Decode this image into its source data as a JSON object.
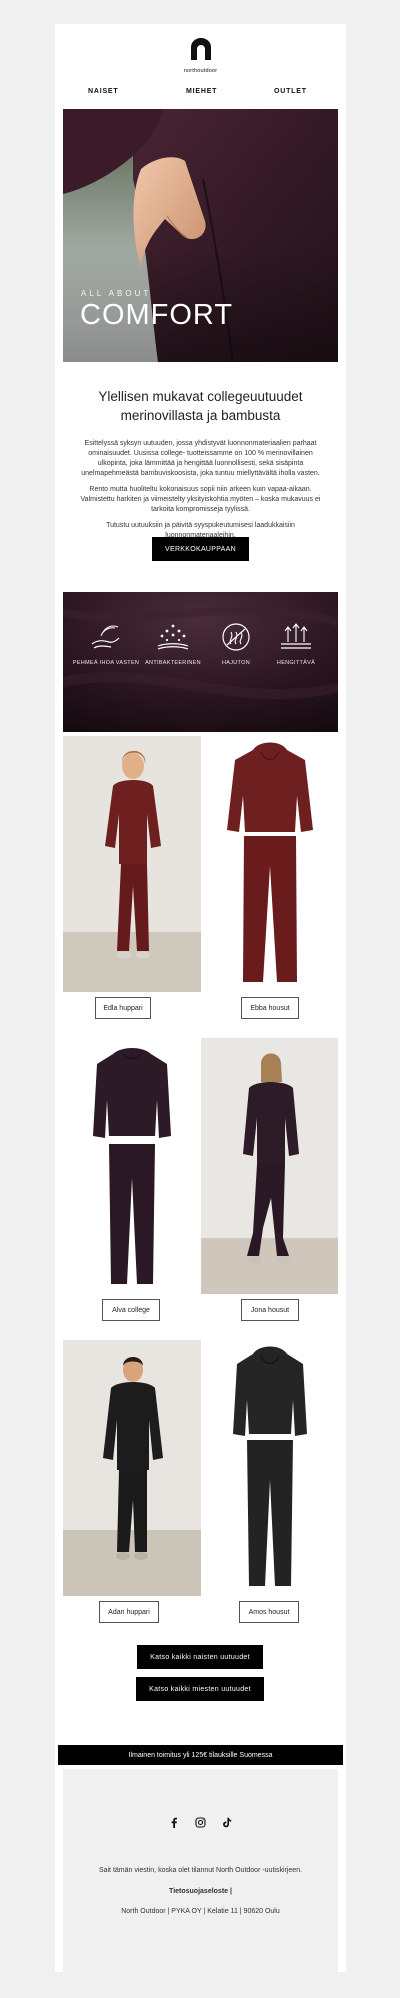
{
  "brand": {
    "logo_text": "northoutdoor"
  },
  "nav": {
    "women": "NAISET",
    "men": "MIEHET",
    "outlet": "OUTLET"
  },
  "hero": {
    "kicker": "ALL ABOUT",
    "title": "COMFORT"
  },
  "intro": {
    "headline": "Ylellisen mukavat collegeuutuudet merinovillasta ja bambusta",
    "p1": "Esittelyssä syksyn uutuuden, jossa yhdistyvät luonnonmateriaalien parhaat ominaisuudet. Uusissa college- tuotteissamme on 100 % merinovillainen ulkopinta, joka lämmittää ja hengittää luonnollisesti, sekä sisäpinta unelmapehmeästä bambuviskoosista, joka tuntuu miellyttävältä iholla vasten.",
    "p2": "Rento mutta huoliteltu kokonaisuus sopii niin arkeen kuin vapaa-aikaan. Valmistettu harkiten ja viimeistelty yksityiskohtia myöten – koska mukavuus ei tarkoita kompromisseja tyylissä.",
    "p3": "Tutustu uutuuksiin ja päivitä syyspukeutumisesi laadukkaisiin luonnonmateriaaleihin.",
    "cta": "VERKKOKAUPPAAN"
  },
  "features": [
    {
      "icon": "soft-hand-icon",
      "label": "PEHMEÄ IHOA VASTEN"
    },
    {
      "icon": "antibacterial-icon",
      "label": "ANTIBAKTEERINEN"
    },
    {
      "icon": "odorless-icon",
      "label": "HAJUTON"
    },
    {
      "icon": "breathable-icon",
      "label": "HENGITTÄVÄ"
    }
  ],
  "products": [
    {
      "label": "Edla huppari"
    },
    {
      "label": "Ebba housut"
    },
    {
      "label": "Alva college"
    },
    {
      "label": "Jona housut"
    },
    {
      "label": "Adan huppari"
    },
    {
      "label": "Amos housut"
    }
  ],
  "cta_women": "Katso kaikki naisten uutuudet",
  "cta_men": "Katso kaikki miesten uutuudet",
  "shipping": "Ilmainen toimitus yli 125€ tilauksille Suomessa",
  "footer": {
    "reason": "Sait tämän viestin, koska olet tilannut North Outdoor -uutiskirjeen.",
    "privacy": "Tietosuojaseloste |",
    "address": "North Outdoor | PYKA OY | Kelatie 11 | 90620 Oulu"
  },
  "colors": {
    "accent": "#000000",
    "burgundy": "#6a1c1c",
    "plum": "#2a1824",
    "page_bg": "#f0f0f0"
  }
}
